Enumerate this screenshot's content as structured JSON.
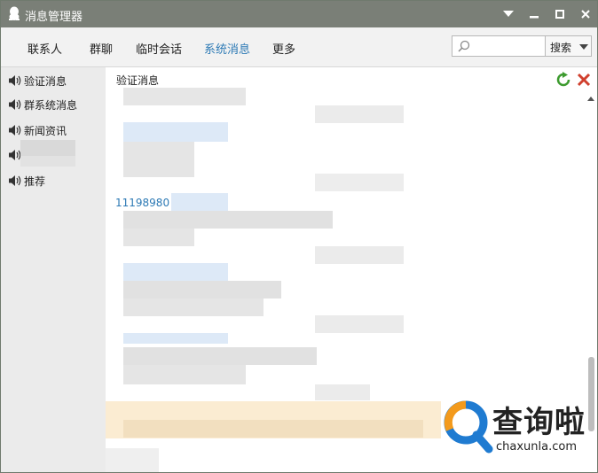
{
  "window": {
    "title": "消息管理器",
    "controls": [
      "dropdown",
      "minimize",
      "maximize",
      "close"
    ]
  },
  "nav": {
    "tabs": [
      {
        "label": "联系人",
        "active": false
      },
      {
        "label": "群聊",
        "active": false
      },
      {
        "label": "临时会话",
        "active": false
      },
      {
        "label": "系统消息",
        "active": true
      },
      {
        "label": "更多",
        "active": false
      }
    ],
    "search_value": "",
    "search_button": "搜索"
  },
  "sidebar": {
    "items": [
      {
        "label": "验证消息",
        "icon": "speaker-icon"
      },
      {
        "label": "群系统消息",
        "icon": "speaker-icon"
      },
      {
        "label": "新闻资讯",
        "icon": "speaker-icon"
      },
      {
        "label": "",
        "icon": "speaker-icon"
      },
      {
        "label": "推荐",
        "icon": "speaker-icon"
      }
    ]
  },
  "content": {
    "title": "验证消息",
    "visible_id": "11198980",
    "actions": [
      "refresh-icon",
      "delete-icon"
    ]
  },
  "watermark": {
    "name": "查询啦",
    "url": "chaxunla.com"
  },
  "colors": {
    "titlebar": "#7a7f77",
    "active_tab": "#2d7ab5",
    "highlight_row": "#fbecd2"
  }
}
